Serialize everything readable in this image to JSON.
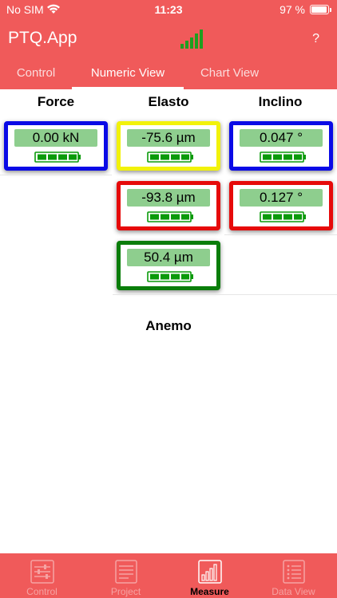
{
  "status_bar": {
    "carrier": "No SIM",
    "time": "11:23",
    "battery_percent": "97 %"
  },
  "nav": {
    "title": "PTQ.App",
    "help": "?",
    "signal_icon": "signal-bars-icon"
  },
  "tabs": [
    {
      "label": "Control",
      "active": false
    },
    {
      "label": "Numeric View",
      "active": true
    },
    {
      "label": "Chart View",
      "active": false
    }
  ],
  "columns": [
    {
      "title": "Force",
      "sensors": [
        {
          "value": "0.00 kN",
          "border_color": "#0a0ae6"
        }
      ]
    },
    {
      "title": "Elasto",
      "sensors": [
        {
          "value": "-75.6 µm",
          "border_color": "#f2f20a"
        },
        {
          "value": "-93.8 µm",
          "border_color": "#e60a0a"
        },
        {
          "value": "50.4 µm",
          "border_color": "#0a7d0a"
        }
      ]
    },
    {
      "title": "Inclino",
      "sensors": [
        {
          "value": "0.047 °",
          "border_color": "#0a0ae6"
        },
        {
          "value": "0.127 °",
          "border_color": "#e60a0a"
        }
      ]
    }
  ],
  "anemo": {
    "title": "Anemo"
  },
  "tab_bar": [
    {
      "label": "Control",
      "icon": "sliders-icon",
      "active": false
    },
    {
      "label": "Project",
      "icon": "document-icon",
      "active": false
    },
    {
      "label": "Measure",
      "icon": "bar-chart-icon",
      "active": true
    },
    {
      "label": "Data View",
      "icon": "list-icon",
      "active": false
    }
  ],
  "colors": {
    "accent": "#f05a5a",
    "value_bg": "#8ece8e",
    "battery_green": "#0a9a0a"
  }
}
